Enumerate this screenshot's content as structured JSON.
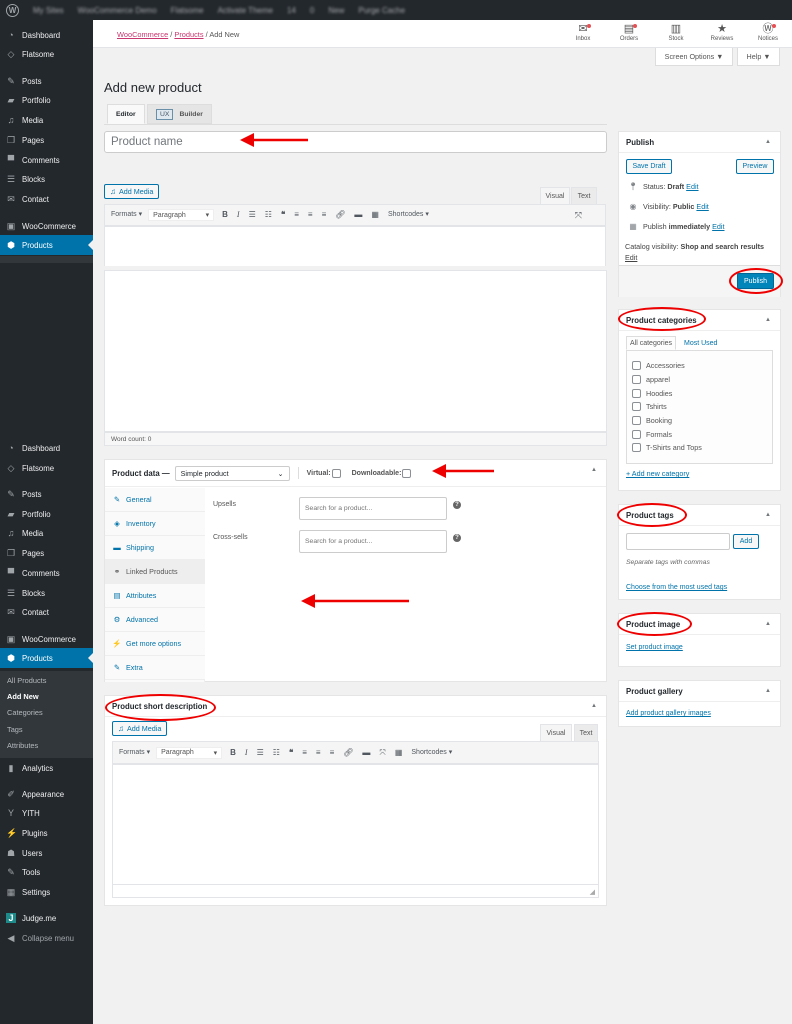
{
  "admin_bar": {
    "items": [
      "My Sites",
      "WooCommerce Demo",
      "Flatsome",
      "Activate Theme",
      "14",
      "0",
      "New",
      "Purge Cache"
    ]
  },
  "sidebar": {
    "top_items": [
      {
        "label": "Dashboard",
        "icon": "dashboard-icon"
      },
      {
        "label": "Flatsome",
        "icon": "flatsome-icon"
      },
      {
        "label": "Posts",
        "icon": "pin-icon"
      },
      {
        "label": "Portfolio",
        "icon": "folder-icon"
      },
      {
        "label": "Media",
        "icon": "media-icon"
      },
      {
        "label": "Pages",
        "icon": "pages-icon"
      },
      {
        "label": "Comments",
        "icon": "comment-icon"
      },
      {
        "label": "Blocks",
        "icon": "blocks-icon"
      },
      {
        "label": "Contact",
        "icon": "mail-icon"
      },
      {
        "label": "WooCommerce",
        "icon": "woo-icon"
      },
      {
        "label": "Products",
        "icon": "box-icon"
      }
    ],
    "bottom_items": [
      {
        "label": "Dashboard",
        "icon": "dashboard-icon"
      },
      {
        "label": "Flatsome",
        "icon": "flatsome-icon"
      },
      {
        "label": "Posts",
        "icon": "pin-icon"
      },
      {
        "label": "Portfolio",
        "icon": "folder-icon"
      },
      {
        "label": "Media",
        "icon": "media-icon"
      },
      {
        "label": "Pages",
        "icon": "pages-icon"
      },
      {
        "label": "Comments",
        "icon": "comment-icon"
      },
      {
        "label": "Blocks",
        "icon": "blocks-icon"
      },
      {
        "label": "Contact",
        "icon": "mail-icon"
      },
      {
        "label": "WooCommerce",
        "icon": "woo-icon"
      },
      {
        "label": "Products",
        "icon": "box-icon"
      }
    ],
    "products_submenu": [
      "All Products",
      "Add New",
      "Categories",
      "Tags",
      "Attributes"
    ],
    "after_items": [
      {
        "label": "Analytics",
        "icon": "analytics-icon"
      },
      {
        "label": "Appearance",
        "icon": "brush-icon"
      },
      {
        "label": "YITH",
        "icon": "yith-icon"
      },
      {
        "label": "Plugins",
        "icon": "plugin-icon"
      },
      {
        "label": "Users",
        "icon": "user-icon"
      },
      {
        "label": "Tools",
        "icon": "wrench-icon"
      },
      {
        "label": "Settings",
        "icon": "settings-icon"
      },
      {
        "label": "Judge.me",
        "icon": "judgeme-icon"
      },
      {
        "label": "Collapse menu",
        "icon": "collapse-icon"
      }
    ]
  },
  "woo_header": {
    "breadcrumb": {
      "root": "WooCommerce",
      "parent": "Products",
      "current": "Add New",
      "sep": "/"
    },
    "activity": [
      {
        "label": "Inbox",
        "badge": true
      },
      {
        "label": "Orders",
        "badge": true
      },
      {
        "label": "Stock",
        "badge": false
      },
      {
        "label": "Reviews",
        "badge": false
      },
      {
        "label": "Notices",
        "badge": true
      }
    ]
  },
  "screen_options": {
    "label": "Screen Options ▼",
    "help": "Help ▼"
  },
  "page": {
    "title": "Add new product",
    "tabs": {
      "editor": "Editor",
      "ux": "UX",
      "builder": "Builder"
    },
    "title_placeholder": "Product name"
  },
  "editor": {
    "add_media": "Add Media",
    "visual": "Visual",
    "text": "Text",
    "formats": "Formats ▾",
    "paragraph": "Paragraph",
    "shortcodes": "Shortcodes ▾",
    "word_count": "Word count: 0"
  },
  "product_data": {
    "label": "Product data —",
    "type": "Simple product",
    "virtual": "Virtual:",
    "downloadable": "Downloadable:",
    "tabs": [
      "General",
      "Inventory",
      "Shipping",
      "Linked Products",
      "Attributes",
      "Advanced",
      "Get more options",
      "Extra"
    ],
    "active_tab": "Linked Products",
    "fields": [
      {
        "label": "Upsells",
        "placeholder": "Search for a product..."
      },
      {
        "label": "Cross-sells",
        "placeholder": "Search for a product..."
      }
    ]
  },
  "short_description": {
    "title": "Product short description"
  },
  "publish": {
    "title": "Publish",
    "save_draft": "Save Draft",
    "preview": "Preview",
    "status_label": "Status:",
    "status_value": "Draft",
    "visibility_label": "Visibility:",
    "visibility_value": "Public",
    "publish_label": "Publish",
    "publish_value": "immediately",
    "catalog_label": "Catalog visibility:",
    "catalog_value": "Shop and search results",
    "edit": "Edit",
    "publish_button": "Publish"
  },
  "categories": {
    "title": "Product categories",
    "tab_all": "All categories",
    "tab_most_used": "Most Used",
    "items": [
      "Accessories",
      "apparel",
      "Hoodies",
      "Tshirts",
      "Booking",
      "Formals",
      "T-Shirts and Tops"
    ],
    "add_new": "+ Add new category"
  },
  "tags": {
    "title": "Product tags",
    "add": "Add",
    "hint": "Separate tags with commas",
    "choose": "Choose from the most used tags"
  },
  "product_image": {
    "title": "Product image",
    "link": "Set product image"
  },
  "gallery": {
    "title": "Product gallery",
    "link": "Add product gallery images"
  },
  "colors": {
    "accent": "#0073aa",
    "sidebar": "#23282d",
    "annotation": "#ee0000",
    "woo_link": "#c9356e"
  }
}
